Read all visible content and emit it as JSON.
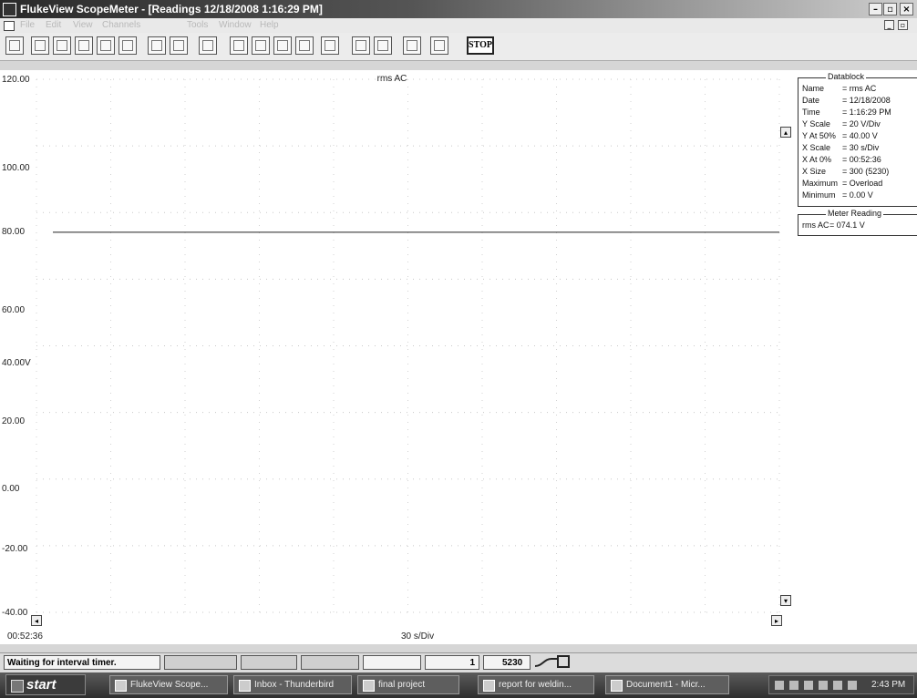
{
  "window": {
    "title": "FlukeView ScopeMeter - [Readings 12/18/2008 1:16:29 PM]",
    "minimize": "–",
    "maximize": "▫",
    "close": "×"
  },
  "menu": [
    "File",
    "Edit",
    "View",
    "Channels",
    "Tools",
    "Window",
    "Help"
  ],
  "toolbar": {
    "stop_label": "STOP"
  },
  "chart_data": {
    "type": "line",
    "title": "rms AC",
    "xlabel": "30 s/Div",
    "x_start_label": "00:52:36",
    "yticks": [
      "120.00",
      "100.00",
      "80.00",
      "60.00",
      "40.00V",
      "20.00",
      "0.00",
      "-20.00",
      "-40.00"
    ],
    "ylim": [
      -40,
      120
    ],
    "series": [
      {
        "name": "rms AC",
        "x_start": 0,
        "x_end": 300,
        "value": 74.1
      }
    ],
    "grid": "dotted"
  },
  "datablock": {
    "title": "Datablock",
    "rows": [
      {
        "key": "Name",
        "value": "= rms AC"
      },
      {
        "key": "Date",
        "value": "= 12/18/2008"
      },
      {
        "key": "Time",
        "value": "= 1:16:29 PM"
      },
      {
        "key": "Y Scale",
        "value": "= 20 V/Div"
      },
      {
        "key": "Y At 50%",
        "value": "= 40.00 V"
      },
      {
        "key": "X Scale",
        "value": "= 30 s/Div"
      },
      {
        "key": "X At 0%",
        "value": "= 00:52:36"
      },
      {
        "key": "X Size",
        "value": "= 300 (5230)"
      },
      {
        "key": "Maximum",
        "value": "= Overload"
      },
      {
        "key": "Minimum",
        "value": "= 0.00 V"
      }
    ]
  },
  "meter_reading": {
    "title": "Meter Reading",
    "key": "rms AC",
    "value": "= 074.1 V"
  },
  "status": {
    "message": "Waiting for interval timer.",
    "value1": "1",
    "value2": "5230"
  },
  "taskbar": {
    "start": "start",
    "tasks": [
      "FlukeView Scope...",
      "Inbox - Thunderbird",
      "final project",
      "report for weldin...",
      "Document1 - Micr..."
    ],
    "clock": "2:43 PM"
  }
}
